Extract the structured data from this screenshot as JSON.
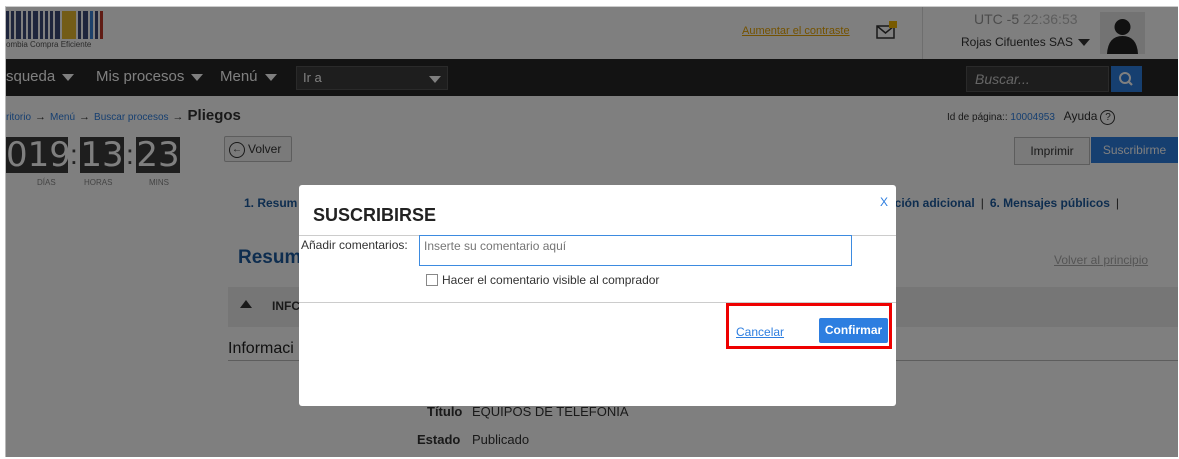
{
  "header": {
    "logo_text": "ombia Compra Eficiente",
    "contrast_link": "Aumentar el contraste",
    "utc_label": "UTC -5",
    "utc_time": "22:36:53",
    "company": "Rojas Cifuentes SAS"
  },
  "nav": {
    "items": [
      "squeda",
      "Mis procesos",
      "Menú"
    ],
    "goto_label": "Ir a",
    "search_placeholder": "Buscar..."
  },
  "breadcrumb": {
    "items": [
      "ritorio",
      "Menú",
      "Buscar procesos"
    ],
    "current": "Pliegos",
    "arrow": "→"
  },
  "page_info": {
    "label": "Id de página::",
    "id": "10004953",
    "help": "Ayuda"
  },
  "countdown": {
    "days": "019",
    "hours": "13",
    "mins": "23",
    "labels": [
      "DÍAS",
      "HORAS",
      "MINS"
    ]
  },
  "actions": {
    "back": "Volver",
    "print": "Imprimir",
    "subscribe": "Suscribirme"
  },
  "tabs": {
    "left": "1. Resum",
    "right_1": "ación adicional",
    "right_2": "6. Mensajes públicos",
    "sep": "|"
  },
  "section": {
    "title": "Resum",
    "back_top": "Volver al principio",
    "band_text": "INFC",
    "info_title": "Informaci"
  },
  "fields": [
    {
      "label": "Título",
      "value": "EQUIPOS DE TELEFONIA"
    },
    {
      "label": "Estado",
      "value": "Publicado"
    }
  ],
  "modal": {
    "title": "SUSCRIBIRSE",
    "close": "X",
    "comment_label": "Añadir comentarios:",
    "comment_placeholder": "Inserte su comentario aquí",
    "checkbox_label": "Hacer el comentario visible al comprador",
    "cancel": "Cancelar",
    "confirm": "Confirmar"
  },
  "colors": {
    "accent": "#2d7ee0",
    "nav_bg": "#262626",
    "highlight": "#e00000"
  }
}
